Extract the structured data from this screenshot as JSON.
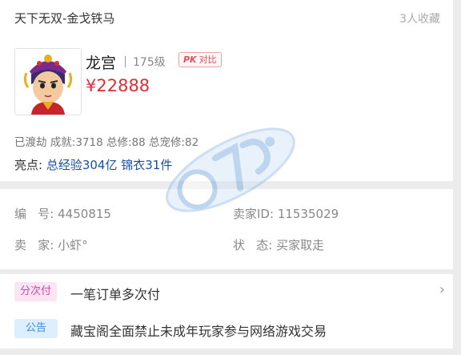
{
  "listing": {
    "server": "天下无双-金戈铁马",
    "favorites": "3人收藏",
    "role_name": "龙宫",
    "level": "175级",
    "pk_label": "对比",
    "pk_icon_text": "PK",
    "price": "¥22888",
    "stats": "已渡劫 成就:3718 总修:88 总宠修:82",
    "highlight_label": "亮点:",
    "highlight_value": "总经验304亿 锦衣31件"
  },
  "info": {
    "id_label": "编   号:",
    "id_value": "4450815",
    "seller_id_label": "卖家ID:",
    "seller_id_value": "11535029",
    "seller_label": "卖   家:",
    "seller_value": "小虾°",
    "status_label": "状   态:",
    "status_value": "买家取走"
  },
  "promo": {
    "installment_badge": "分次付",
    "installment_text": "一笔订单多次付",
    "notice_badge": "公告",
    "notice_text": "藏宝阁全面禁止未成年玩家参与网络游戏交易"
  },
  "colors": {
    "price": "#e02e38",
    "highlight": "#1a4fa8",
    "installment_badge_bg": "#fbe4f3",
    "notice_badge_bg": "#ddeefd"
  },
  "icons": {
    "avatar": "character-portrait",
    "chevron": "chevron-right-icon",
    "watermark": "watermark-logo"
  }
}
